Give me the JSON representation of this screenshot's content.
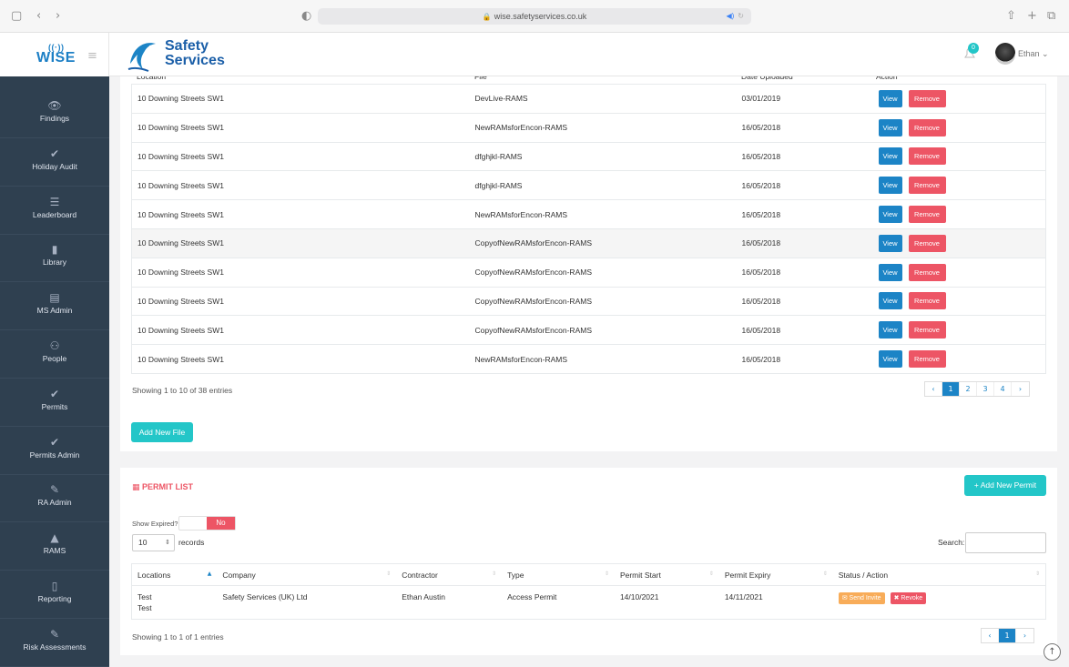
{
  "browser": {
    "url": "wise.safetyservices.co.uk",
    "icons": {
      "sidebar": "▢",
      "back": "‹",
      "forward": "›",
      "shield": "◐",
      "share": "⇧",
      "newtab": "+",
      "tabs": "⧉"
    }
  },
  "app": {
    "logo": "WISE",
    "brand_line1": "Safety",
    "brand_line2": "Services",
    "notification_count": "0",
    "user_name": "Ethan ⌄"
  },
  "sidebar": {
    "items": [
      {
        "label": "Findings",
        "icon": "👁"
      },
      {
        "label": "Holiday Audit",
        "icon": "✔"
      },
      {
        "label": "Leaderboard",
        "icon": "☰"
      },
      {
        "label": "Library",
        "icon": "▮"
      },
      {
        "label": "MS Admin",
        "icon": "▤"
      },
      {
        "label": "People",
        "icon": "⚇"
      },
      {
        "label": "Permits",
        "icon": "✔"
      },
      {
        "label": "Permits Admin",
        "icon": "✔"
      },
      {
        "label": "RA Admin",
        "icon": "✎"
      },
      {
        "label": "RAMS",
        "icon": "▲"
      },
      {
        "label": "Reporting",
        "icon": "▯"
      },
      {
        "label": "Risk Assessments",
        "icon": "✎"
      }
    ]
  },
  "rams": {
    "rows": [
      {
        "location": "10 Downing Streets SW1",
        "file": "DevLive-RAMS",
        "date": "03/01/2019"
      },
      {
        "location": "10 Downing Streets SW1",
        "file": "NewRAMsforEncon-RAMS",
        "date": "16/05/2018"
      },
      {
        "location": "10 Downing Streets SW1",
        "file": "dfghjkl-RAMS",
        "date": "16/05/2018"
      },
      {
        "location": "10 Downing Streets SW1",
        "file": "dfghjkl-RAMS",
        "date": "16/05/2018"
      },
      {
        "location": "10 Downing Streets SW1",
        "file": "NewRAMsforEncon-RAMS",
        "date": "16/05/2018"
      },
      {
        "location": "10 Downing Streets SW1",
        "file": "CopyofNewRAMsforEncon-RAMS",
        "date": "16/05/2018"
      },
      {
        "location": "10 Downing Streets SW1",
        "file": "CopyofNewRAMsforEncon-RAMS",
        "date": "16/05/2018"
      },
      {
        "location": "10 Downing Streets SW1",
        "file": "CopyofNewRAMsforEncon-RAMS",
        "date": "16/05/2018"
      },
      {
        "location": "10 Downing Streets SW1",
        "file": "CopyofNewRAMsforEncon-RAMS",
        "date": "16/05/2018"
      },
      {
        "location": "10 Downing Streets SW1",
        "file": "NewRAMsforEncon-RAMS",
        "date": "16/05/2018"
      }
    ],
    "view_label": "View",
    "remove_label": "Remove",
    "info": "Showing 1 to 10 of 38 entries",
    "pages": [
      "‹",
      "1",
      "2",
      "3",
      "4",
      "›"
    ],
    "active_page": "1",
    "add_file_label": "Add New File"
  },
  "permits": {
    "title": "PERMIT LIST",
    "add_label": "+ Add New Permit",
    "show_expired_label": "Show Expired?",
    "toggle_value": "No",
    "page_size": "10",
    "records_label": "records",
    "search_label": "Search:",
    "search_value": "",
    "columns": [
      "Locations",
      "Company",
      "Contractor",
      "Type",
      "Permit Start",
      "Permit Expiry",
      "Status / Action"
    ],
    "rows": [
      {
        "location": "Test\nTest",
        "company": "Safety Services (UK) Ltd",
        "contractor": "Ethan Austin",
        "type": "Access Permit",
        "start": "14/10/2021",
        "expiry": "14/11/2021",
        "send_label": "✉ Send Invite",
        "revoke_label": "✖ Revoke"
      }
    ],
    "info": "Showing 1 to 1 of 1 entries",
    "pages": [
      "‹",
      "1",
      "›"
    ],
    "active_page": "1"
  },
  "colors": {
    "sidebar": "#2f4050",
    "primary": "#1c84c6",
    "danger": "#ed5565",
    "teal": "#23c6c8",
    "warning": "#f8ac59"
  }
}
